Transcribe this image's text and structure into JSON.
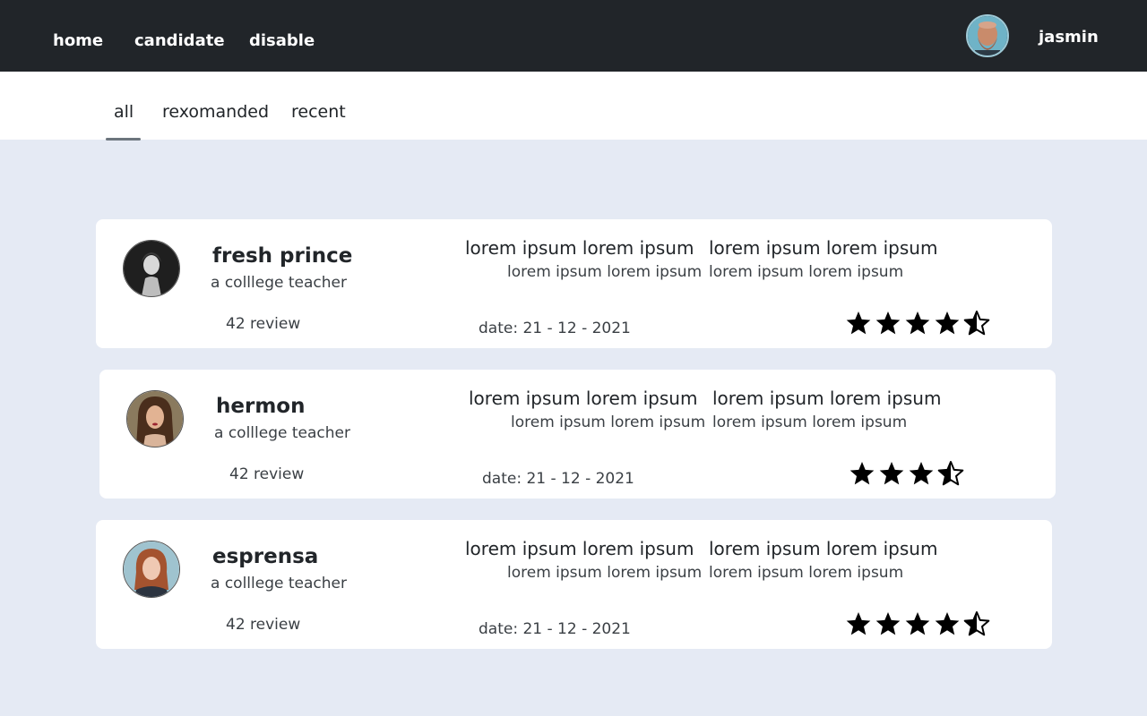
{
  "topnav": {
    "links": [
      "home",
      "candidate",
      "disable"
    ],
    "user": {
      "name": "jasmin"
    }
  },
  "tabs": {
    "items": [
      "all",
      "rexomanded",
      "recent"
    ],
    "active": 0
  },
  "candidates": [
    {
      "name": "fresh prince",
      "role": "a colllege teacher",
      "reviews": "42 review",
      "desc_heading": [
        "lorem ipsum lorem ipsum",
        "lorem ipsum lorem ipsum"
      ],
      "desc_sub": [
        "lorem ipsum lorem ipsum",
        "lorem ipsum lorem ipsum"
      ],
      "date": "date: 21 - 12 - 2021",
      "rating": 4.5
    },
    {
      "name": "hermon",
      "role": "a colllege teacher",
      "reviews": "42 review",
      "desc_heading": [
        "lorem ipsum lorem ipsum",
        "lorem ipsum lorem ipsum"
      ],
      "desc_sub": [
        "lorem ipsum lorem ipsum",
        "lorem ipsum lorem ipsum"
      ],
      "date": "date: 21 - 12 - 2021",
      "rating": 3.5
    },
    {
      "name": "esprensa",
      "role": "a colllege teacher",
      "reviews": "42 review",
      "desc_heading": [
        "lorem ipsum lorem ipsum",
        "lorem ipsum lorem ipsum"
      ],
      "desc_sub": [
        "lorem ipsum lorem ipsum",
        "lorem ipsum lorem ipsum"
      ],
      "date": "date: 21 - 12 - 2021",
      "rating": 4.5
    }
  ],
  "colors": {
    "topbar": "#212529",
    "page_background": "#e5eaf4",
    "star": "#000000"
  }
}
